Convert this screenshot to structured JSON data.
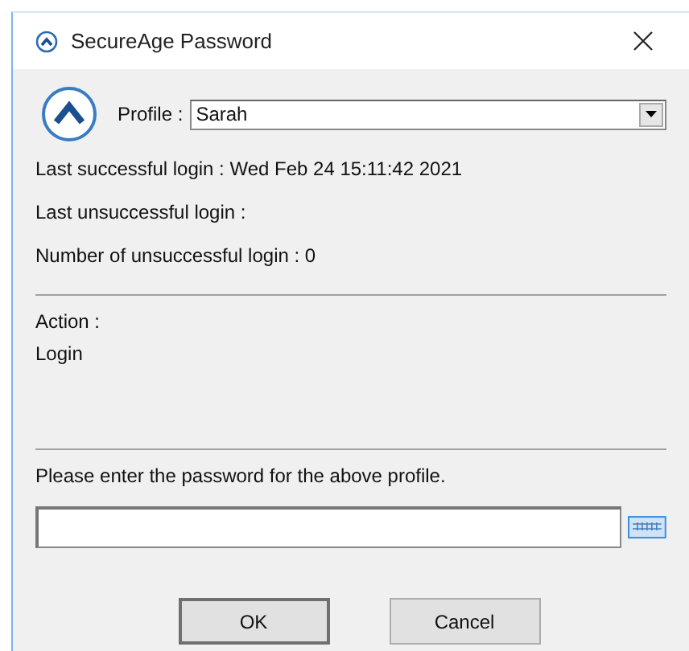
{
  "window": {
    "title": "SecureAge Password"
  },
  "profile": {
    "label": "Profile :",
    "value": "Sarah"
  },
  "info": [
    "Last successful login : Wed Feb 24 15:11:42 2021",
    "Last unsuccessful login :",
    "Number of unsuccessful login : 0"
  ],
  "action": {
    "label": "Action :",
    "value": "Login"
  },
  "password": {
    "prompt": "Please enter the password for the above profile."
  },
  "buttons": [
    {
      "label": "OK",
      "kind": "default"
    },
    {
      "label": "Cancel",
      "kind": "normal"
    }
  ]
}
